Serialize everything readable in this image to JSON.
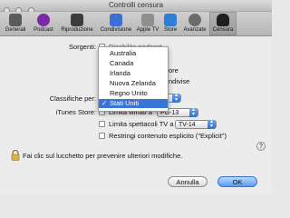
{
  "window": {
    "title": "Controlli censura"
  },
  "toolbar": {
    "items": [
      {
        "label": "Generali",
        "icon": "generali-icon",
        "color": "#5b5b5b"
      },
      {
        "label": "Podcast",
        "icon": "podcast-icon",
        "color": "#7b2aa6"
      },
      {
        "label": "Riproduzione",
        "icon": "riproduzione-icon",
        "color": "#3d3d3d"
      },
      {
        "label": "Condivisione",
        "icon": "condivisione-icon",
        "color": "#3c6fd3"
      },
      {
        "label": "Apple TV",
        "icon": "apple-tv-icon",
        "color": "#8f8f8f"
      },
      {
        "label": "Store",
        "icon": "store-icon",
        "color": "#2d7ed6"
      },
      {
        "label": "Avanzate",
        "icon": "avanzate-icon",
        "color": "#6b6b6b"
      },
      {
        "label": "Censura",
        "icon": "censura-icon",
        "color": "#1f1f1f",
        "selected": true
      }
    ]
  },
  "form": {
    "sorgenti_label": "Sorgenti:",
    "sorgenti_hidden_1": "Disabilita podcast",
    "sorgenti_hidden_2": "ore",
    "sorgenti_hidden_3": "ndivise",
    "classifiche_label": "Classifiche per:",
    "classifiche_value": "Stati Uniti",
    "itunes_label": "iTunes Store:",
    "limita_filmati_label": "Limita filmati a",
    "limita_filmati_value": "PG-13",
    "limita_tv_label": "Limita spettacoli TV a",
    "limita_tv_value": "TV-14",
    "restringi_label": "Restringi contenuto esplicito (\"Explicit\")"
  },
  "country_menu": {
    "items": [
      "Australia",
      "Canada",
      "Irlanda",
      "Nuova Zelanda",
      "Regno Unito",
      "Stati Uniti"
    ],
    "selected": "Stati Uniti",
    "check_glyph": "✓"
  },
  "footer": {
    "lock_text": "Fai clic sul lucchetto per prevenire ulteriori modifiche.",
    "cancel_label": "Annulla",
    "ok_label": "OK",
    "help_label": "?"
  }
}
